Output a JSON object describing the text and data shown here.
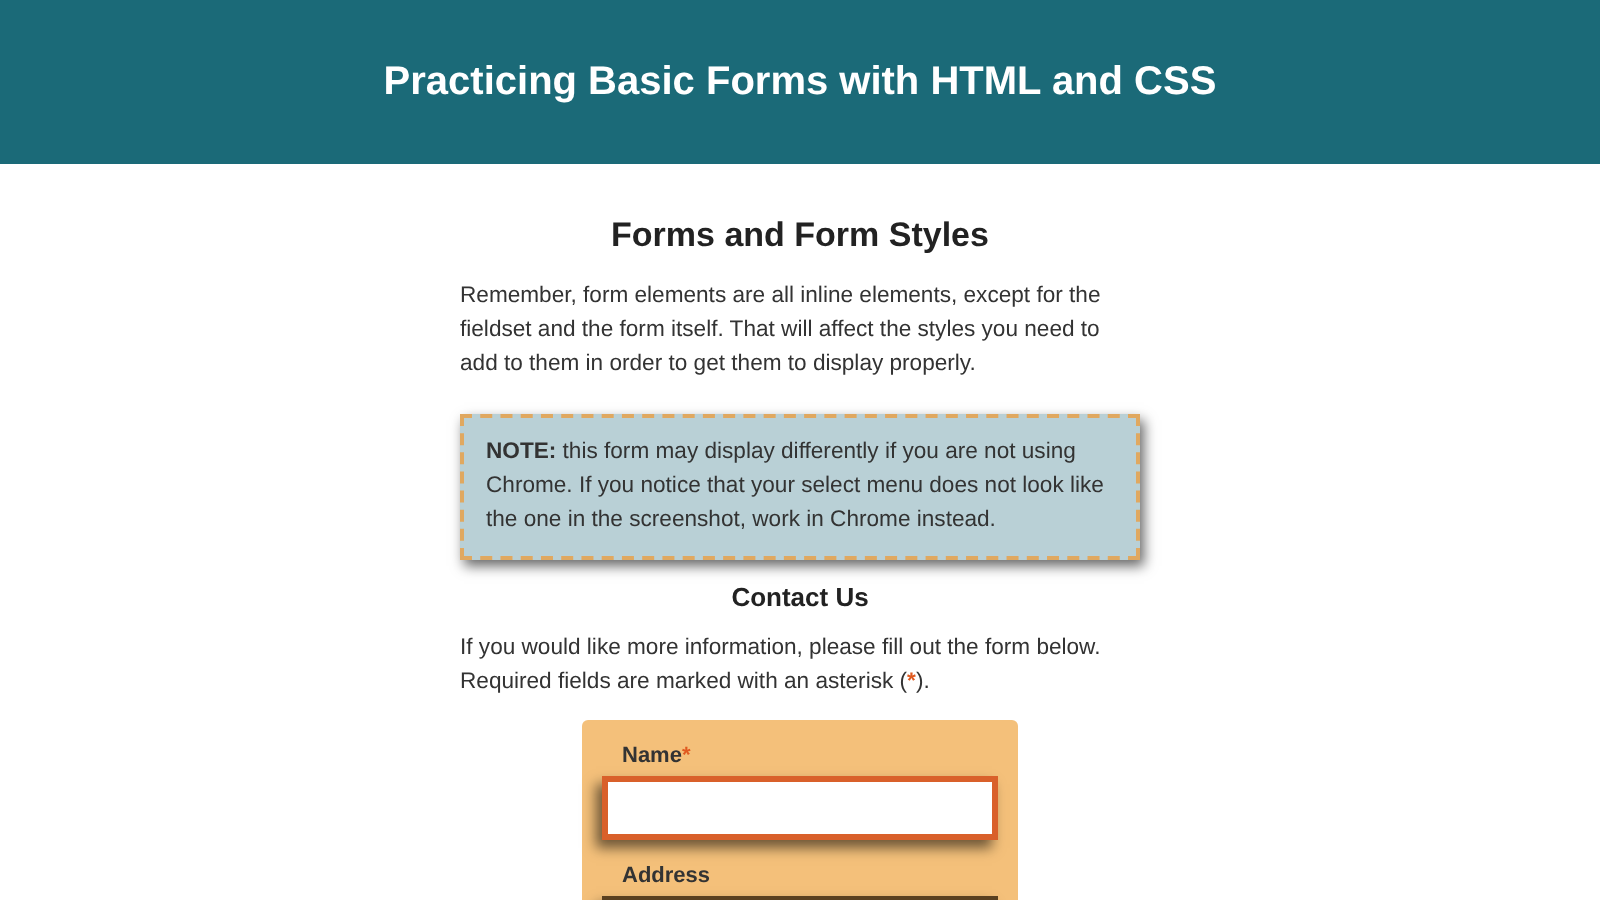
{
  "header": {
    "title": "Practicing Basic Forms with HTML and CSS"
  },
  "section": {
    "heading": "Forms and Form Styles",
    "intro": "Remember, form elements are all inline elements, except for the fieldset and the form itself. That will affect the styles you need to add to them in order to get them to display properly."
  },
  "note": {
    "text": "**NOTE:** this form may display differently if you are not using Chrome. If you notice that your select menu does not look like the one in the screenshot, work in Chrome instead."
  },
  "contact": {
    "heading": "Contact Us",
    "intro_before": "If you would like more information, please fill out the form below. Required fields are marked with an asterisk (",
    "required_marker": "*",
    "intro_after": ")."
  },
  "form": {
    "fields": [
      {
        "label": "Name",
        "required": true
      },
      {
        "label": "Address",
        "required": false
      }
    ]
  }
}
